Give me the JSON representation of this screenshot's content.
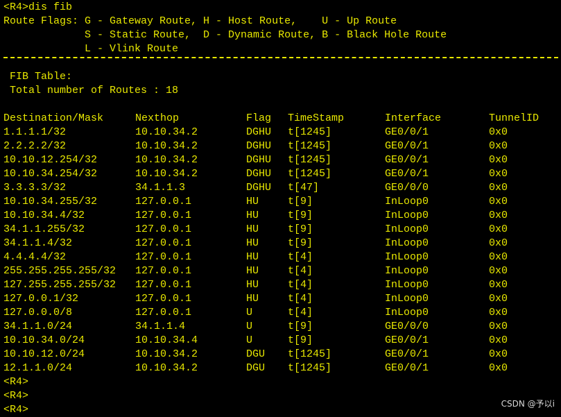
{
  "colors": {
    "background": "#000000",
    "text": "#e8e800",
    "watermark": "#d8d8d8"
  },
  "prompt_command": "<R4>dis fib",
  "flags": {
    "line1": "Route Flags: G - Gateway Route, H - Host Route,    U - Up Route",
    "line2": "             S - Static Route,  D - Dynamic Route, B - Black Hole Route",
    "line3": "             L - Vlink Route"
  },
  "fib": {
    "title": " FIB Table:",
    "total": " Total number of Routes : 18"
  },
  "table": {
    "headers": {
      "destination": "Destination/Mask",
      "nexthop": "Nexthop",
      "flag": "Flag",
      "timestamp": "TimeStamp",
      "interface": "Interface",
      "tunnelid": "TunnelID"
    },
    "rows": [
      {
        "dest": "1.1.1.1/32",
        "nexthop": "10.10.34.2",
        "flag": "DGHU",
        "time": "t[1245]",
        "intf": "GE0/0/1",
        "tunnel": "0x0"
      },
      {
        "dest": "2.2.2.2/32",
        "nexthop": "10.10.34.2",
        "flag": "DGHU",
        "time": "t[1245]",
        "intf": "GE0/0/1",
        "tunnel": "0x0"
      },
      {
        "dest": "10.10.12.254/32",
        "nexthop": "10.10.34.2",
        "flag": "DGHU",
        "time": "t[1245]",
        "intf": "GE0/0/1",
        "tunnel": "0x0"
      },
      {
        "dest": "10.10.34.254/32",
        "nexthop": "10.10.34.2",
        "flag": "DGHU",
        "time": "t[1245]",
        "intf": "GE0/0/1",
        "tunnel": "0x0"
      },
      {
        "dest": "3.3.3.3/32",
        "nexthop": "34.1.1.3",
        "flag": "DGHU",
        "time": "t[47]",
        "intf": "GE0/0/0",
        "tunnel": "0x0"
      },
      {
        "dest": "10.10.34.255/32",
        "nexthop": "127.0.0.1",
        "flag": "HU",
        "time": "t[9]",
        "intf": "InLoop0",
        "tunnel": "0x0"
      },
      {
        "dest": "10.10.34.4/32",
        "nexthop": "127.0.0.1",
        "flag": "HU",
        "time": "t[9]",
        "intf": "InLoop0",
        "tunnel": "0x0"
      },
      {
        "dest": "34.1.1.255/32",
        "nexthop": "127.0.0.1",
        "flag": "HU",
        "time": "t[9]",
        "intf": "InLoop0",
        "tunnel": "0x0"
      },
      {
        "dest": "34.1.1.4/32",
        "nexthop": "127.0.0.1",
        "flag": "HU",
        "time": "t[9]",
        "intf": "InLoop0",
        "tunnel": "0x0"
      },
      {
        "dest": "4.4.4.4/32",
        "nexthop": "127.0.0.1",
        "flag": "HU",
        "time": "t[4]",
        "intf": "InLoop0",
        "tunnel": "0x0"
      },
      {
        "dest": "255.255.255.255/32",
        "nexthop": "127.0.0.1",
        "flag": "HU",
        "time": "t[4]",
        "intf": "InLoop0",
        "tunnel": "0x0"
      },
      {
        "dest": "127.255.255.255/32",
        "nexthop": "127.0.0.1",
        "flag": "HU",
        "time": "t[4]",
        "intf": "InLoop0",
        "tunnel": "0x0"
      },
      {
        "dest": "127.0.0.1/32",
        "nexthop": "127.0.0.1",
        "flag": "HU",
        "time": "t[4]",
        "intf": "InLoop0",
        "tunnel": "0x0"
      },
      {
        "dest": "127.0.0.0/8",
        "nexthop": "127.0.0.1",
        "flag": "U",
        "time": "t[4]",
        "intf": "InLoop0",
        "tunnel": "0x0"
      },
      {
        "dest": "34.1.1.0/24",
        "nexthop": "34.1.1.4",
        "flag": "U",
        "time": "t[9]",
        "intf": "GE0/0/0",
        "tunnel": "0x0"
      },
      {
        "dest": "10.10.34.0/24",
        "nexthop": "10.10.34.4",
        "flag": "U",
        "time": "t[9]",
        "intf": "GE0/0/1",
        "tunnel": "0x0"
      },
      {
        "dest": "10.10.12.0/24",
        "nexthop": "10.10.34.2",
        "flag": "DGU",
        "time": "t[1245]",
        "intf": "GE0/0/1",
        "tunnel": "0x0"
      },
      {
        "dest": "12.1.1.0/24",
        "nexthop": "10.10.34.2",
        "flag": "DGU",
        "time": "t[1245]",
        "intf": "GE0/0/1",
        "tunnel": "0x0"
      }
    ]
  },
  "trailing_prompts": [
    "<R4>",
    "<R4>",
    "<R4>"
  ],
  "watermark": "CSDN @予以i"
}
